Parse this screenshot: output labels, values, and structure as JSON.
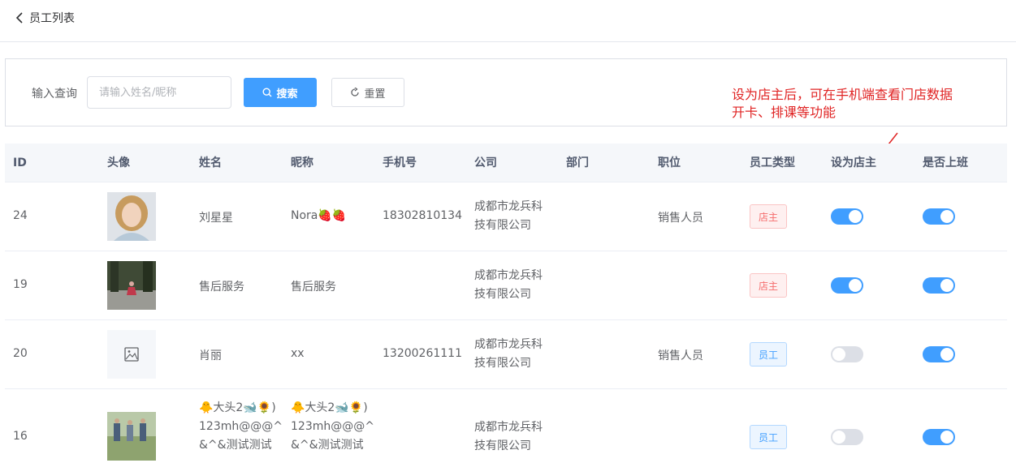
{
  "header": {
    "title": "员工列表"
  },
  "search": {
    "label": "输入查询",
    "placeholder": "请输入姓名/昵称",
    "search_label": "搜索",
    "reset_label": "重置"
  },
  "annotation": {
    "line1": "设为店主后，可在手机端查看门店数据",
    "line2": "开卡、排课等功能"
  },
  "table": {
    "columns": [
      "ID",
      "头像",
      "姓名",
      "昵称",
      "手机号",
      "公司",
      "部门",
      "职位",
      "员工类型",
      "设为店主",
      "是否上班"
    ],
    "rows": [
      {
        "id": "24",
        "avatar": "portrait-photo",
        "name": "刘星星",
        "nickname": "Nora🍓🍓",
        "phone": "18302810134",
        "company_l1": "成都市龙兵科",
        "company_l2": "技有限公司",
        "dept": "",
        "position": "销售人员",
        "type": "店主",
        "is_owner": true,
        "on_duty": true
      },
      {
        "id": "19",
        "avatar": "outdoor-photo",
        "name": "售后服务",
        "nickname": "售后服务",
        "phone": "",
        "company_l1": "成都市龙兵科",
        "company_l2": "技有限公司",
        "dept": "",
        "position": "",
        "type": "店主",
        "is_owner": true,
        "on_duty": true
      },
      {
        "id": "20",
        "avatar": "image-placeholder-icon",
        "name": "肖丽",
        "nickname": "xx",
        "phone": "13200261111",
        "company_l1": "成都市龙兵科",
        "company_l2": "技有限公司",
        "dept": "",
        "position": "销售人员",
        "type": "员工",
        "is_owner": false,
        "on_duty": true
      },
      {
        "id": "16",
        "avatar": "group-photo",
        "name_l1": "🐥大头2🐋🌻)",
        "name_l2": "123mh@@@^",
        "name_l3": "&^&测试测试",
        "nickname_l1": "🐥大头2🐋🌻)",
        "nickname_l2": "123mh@@@^",
        "nickname_l3": "&^&测试测试",
        "phone": "",
        "company_l1": "成都市龙兵科",
        "company_l2": "技有限公司",
        "dept": "",
        "position": "",
        "type": "员工",
        "is_owner": false,
        "on_duty": true
      }
    ]
  },
  "colors": {
    "primary": "#409eff",
    "owner_tag": "#f56c6c",
    "annotation": "#e02424"
  }
}
